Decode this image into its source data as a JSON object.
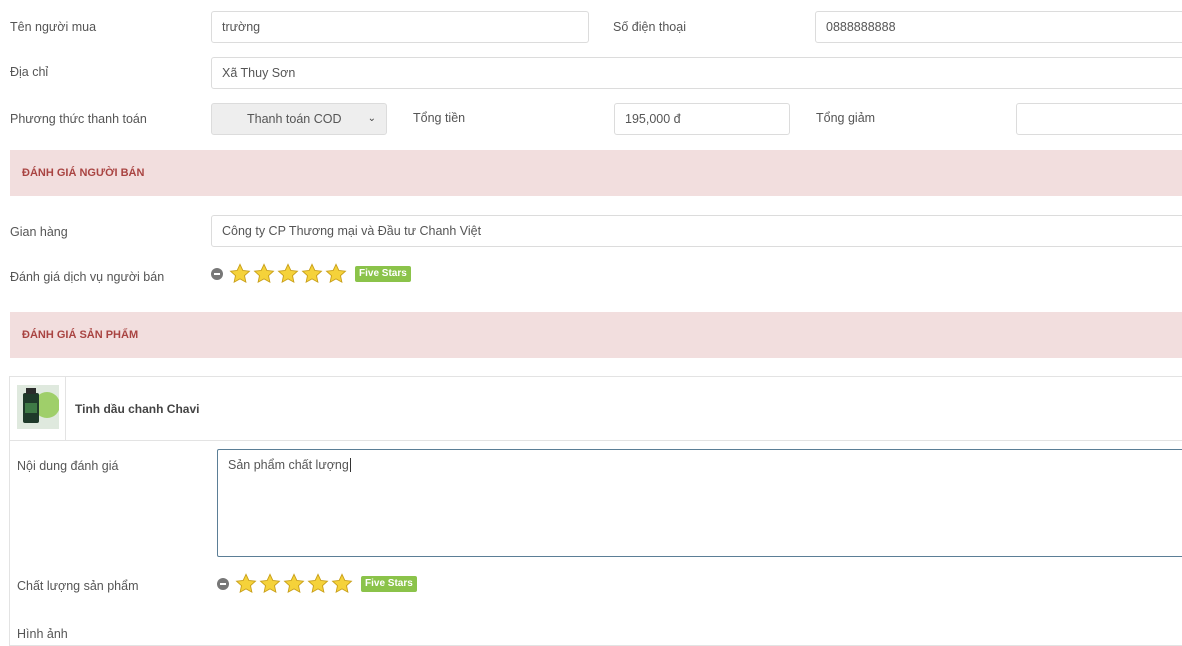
{
  "order": {
    "buyer_label": "Tên người mua",
    "buyer_value": "trường",
    "phone_label": "Số điện thoại",
    "phone_value": "0888888888",
    "address_label": "Địa chỉ",
    "address_value": "Xã Thuy Sơn",
    "payment_label": "Phương thức thanh toán",
    "payment_value": "Thanh toán COD",
    "total_label": "Tổng tiền",
    "total_value": "195,000 đ",
    "discount_label": "Tổng giảm",
    "discount_value": ""
  },
  "seller_review": {
    "title": "ĐÁNH GIÁ NGƯỜI BÁN",
    "shop_label": "Gian hàng",
    "shop_value": "Công ty CP Thương mại và Đầu tư Chanh Việt",
    "service_label": "Đánh giá dịch vụ người bán",
    "rating": 5,
    "rating_max": 5,
    "rating_badge": "Five Stars"
  },
  "product_review": {
    "title": "ĐÁNH GIÁ SẢN PHẨM",
    "product_name": "Tinh dầu chanh Chavi",
    "content_label": "Nội dung đánh giá",
    "content_value": "Sản phẩm chất lượng",
    "quality_label": "Chất lượng sản phẩm",
    "rating": 5,
    "rating_max": 5,
    "rating_badge": "Five Stars",
    "images_label": "Hình ảnh"
  },
  "colors": {
    "section_bg": "#f2dede",
    "section_text": "#a94442",
    "star_fill": "#f5d23a",
    "badge_bg": "#8bc34a"
  }
}
